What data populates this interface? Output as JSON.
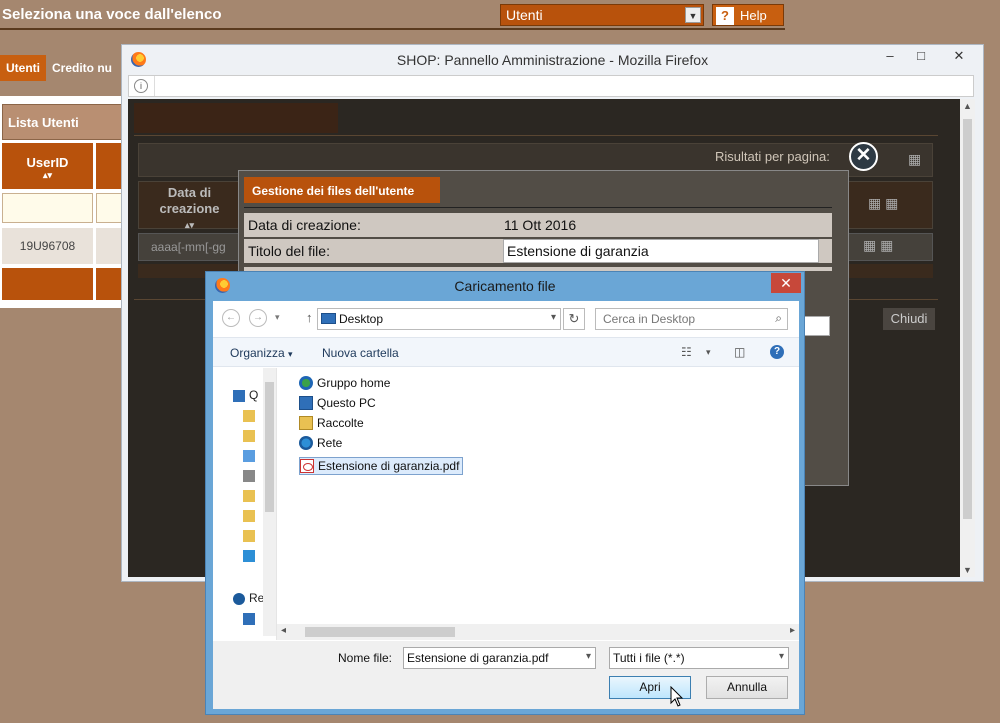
{
  "bg": {
    "page_title": "Seleziona una voce dall'elenco",
    "select_value": "Utenti",
    "help_label": "Help",
    "tabs": [
      "Utenti",
      "Credito nu"
    ],
    "lista_title": "Lista Utenti",
    "col_userid": "UserID",
    "sort_glyph": "▴▾",
    "row_userid": "19U96708"
  },
  "firefox": {
    "title": "SHOP: Pannello Amministrazione - Mozilla Firefox",
    "min": "‒",
    "max": "□",
    "close": "✕",
    "info": "i",
    "risultati_label": "Risultati per pagina:",
    "col_data_creazione": "Data di creazione",
    "sort_glyph": "▴▾",
    "date_placeholder": "aaaa[-mm[-gg",
    "chiudi_label": "Chiudi",
    "close_circle": "✕"
  },
  "gestione": {
    "tab_title": "Gestione dei files dell'utente",
    "data_label": "Data di creazione:",
    "data_value": "11 Ott 2016",
    "titolo_label": "Titolo del file:",
    "titolo_value": "Estensione di garanzia"
  },
  "dialog": {
    "title": "Caricamento file",
    "close": "✕",
    "back": "←",
    "forward": "→",
    "dropdown": "▾",
    "up": "↑",
    "address": "Desktop",
    "refresh": "↻",
    "search_placeholder": "Cerca in Desktop",
    "search_icon": "⌕",
    "organizza": "Organizza",
    "organizza_arrow": "▾",
    "nuova_cartella": "Nuova cartella",
    "view_icon": "☷",
    "view_arrow": "▾",
    "pane_icon": "◫",
    "help_icon": "?",
    "tree_labels": [
      "Q",
      "Re"
    ],
    "items": [
      {
        "label": "Gruppo home",
        "icon": "homegroup-icon"
      },
      {
        "label": "Questo PC",
        "icon": "computer-icon"
      },
      {
        "label": "Raccolte",
        "icon": "libraries-icon"
      },
      {
        "label": "Rete",
        "icon": "network-icon"
      },
      {
        "label": "Estensione di garanzia.pdf",
        "icon": "pdf-file-icon",
        "selected": true
      }
    ],
    "scroll_left": "◂",
    "scroll_right": "▸",
    "nome_file_label": "Nome file:",
    "nome_file_value": "Estensione di garanzia.pdf",
    "file_type": "Tutti i file (*.*)",
    "apri": "Apri",
    "annulla": "Annulla"
  },
  "colors": {
    "page_bg": "#a5876f",
    "accent_orange": "#b8520c",
    "dark_content": "#2b2722",
    "dialog_frame": "#6aa6d6"
  }
}
